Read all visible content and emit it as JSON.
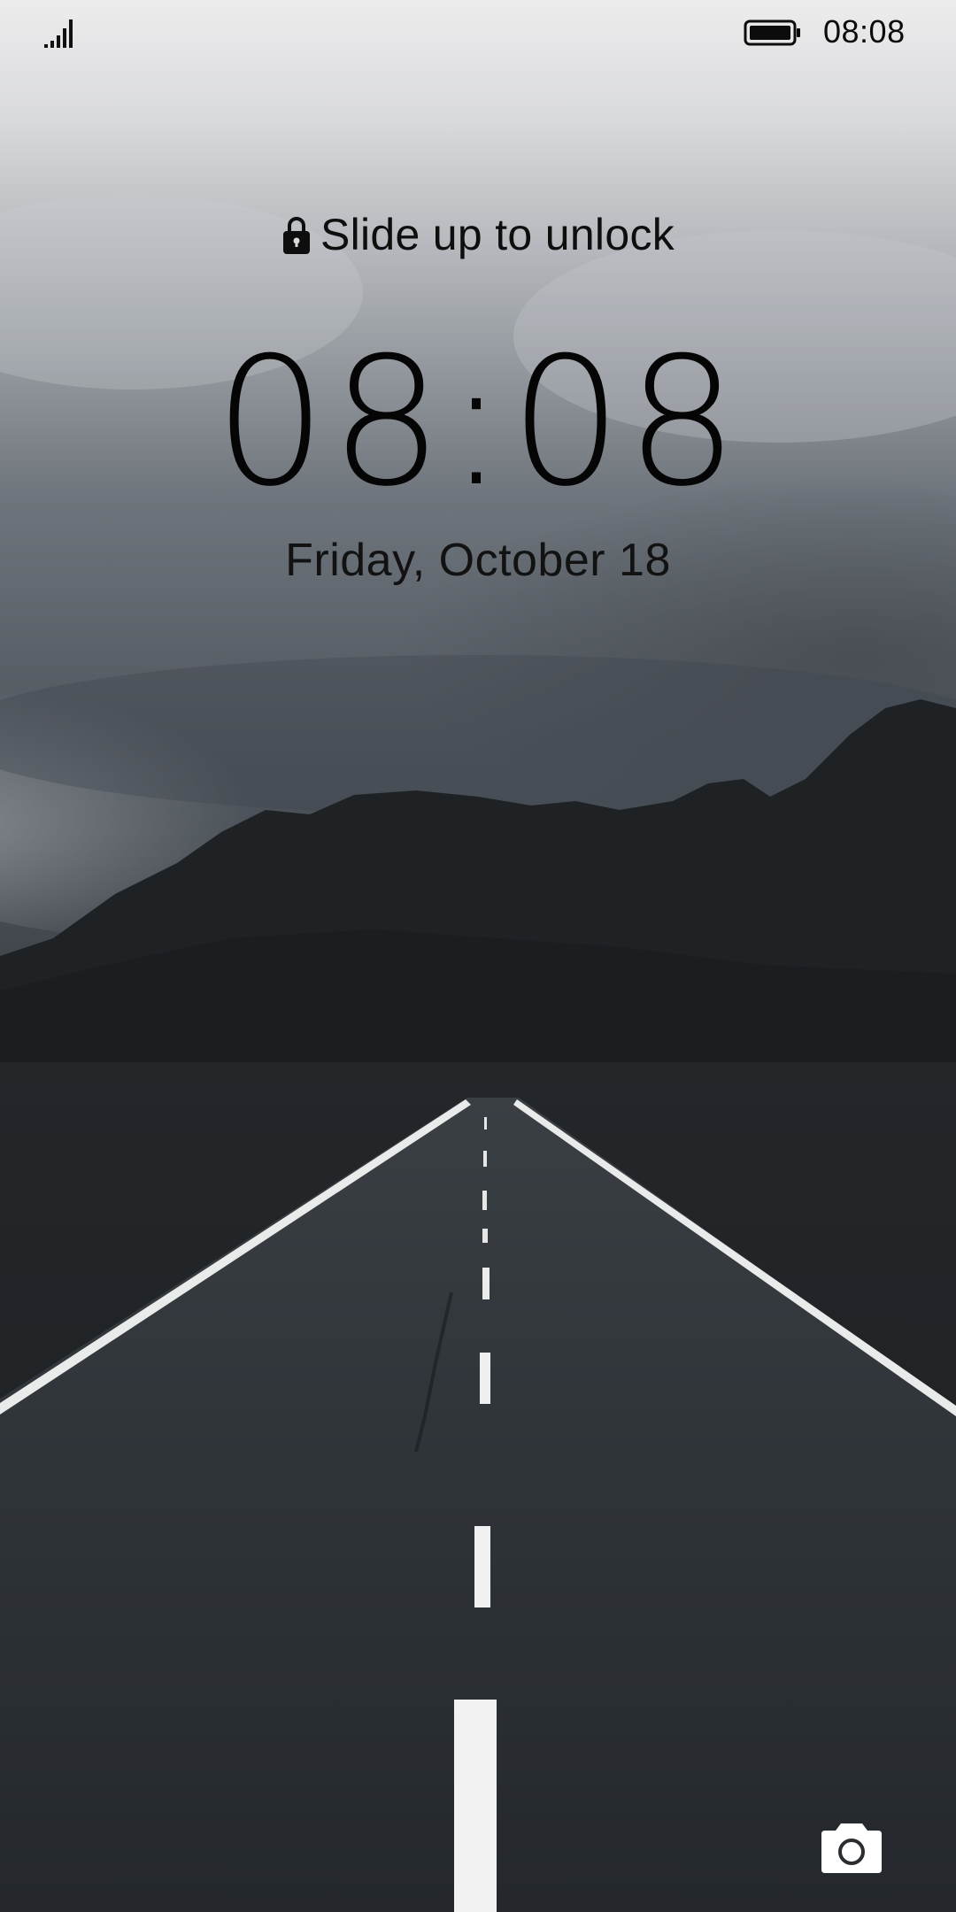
{
  "status_bar": {
    "signal_icon": "cellular-signal-icon",
    "battery_icon": "battery-full-icon",
    "time": "08:08"
  },
  "lock_screen": {
    "lock_icon": "lock-icon",
    "unlock_hint": "Slide up to unlock",
    "clock": "08:08",
    "date": "Friday, October 18",
    "camera_icon": "camera-icon"
  },
  "wallpaper": {
    "description_colors": {
      "sky_top": "#e8e9ea",
      "sky_mid": "#7d8288",
      "mountains": "#1d2023",
      "road": "#2b2f33",
      "road_markings": "#f2f2f2"
    }
  }
}
